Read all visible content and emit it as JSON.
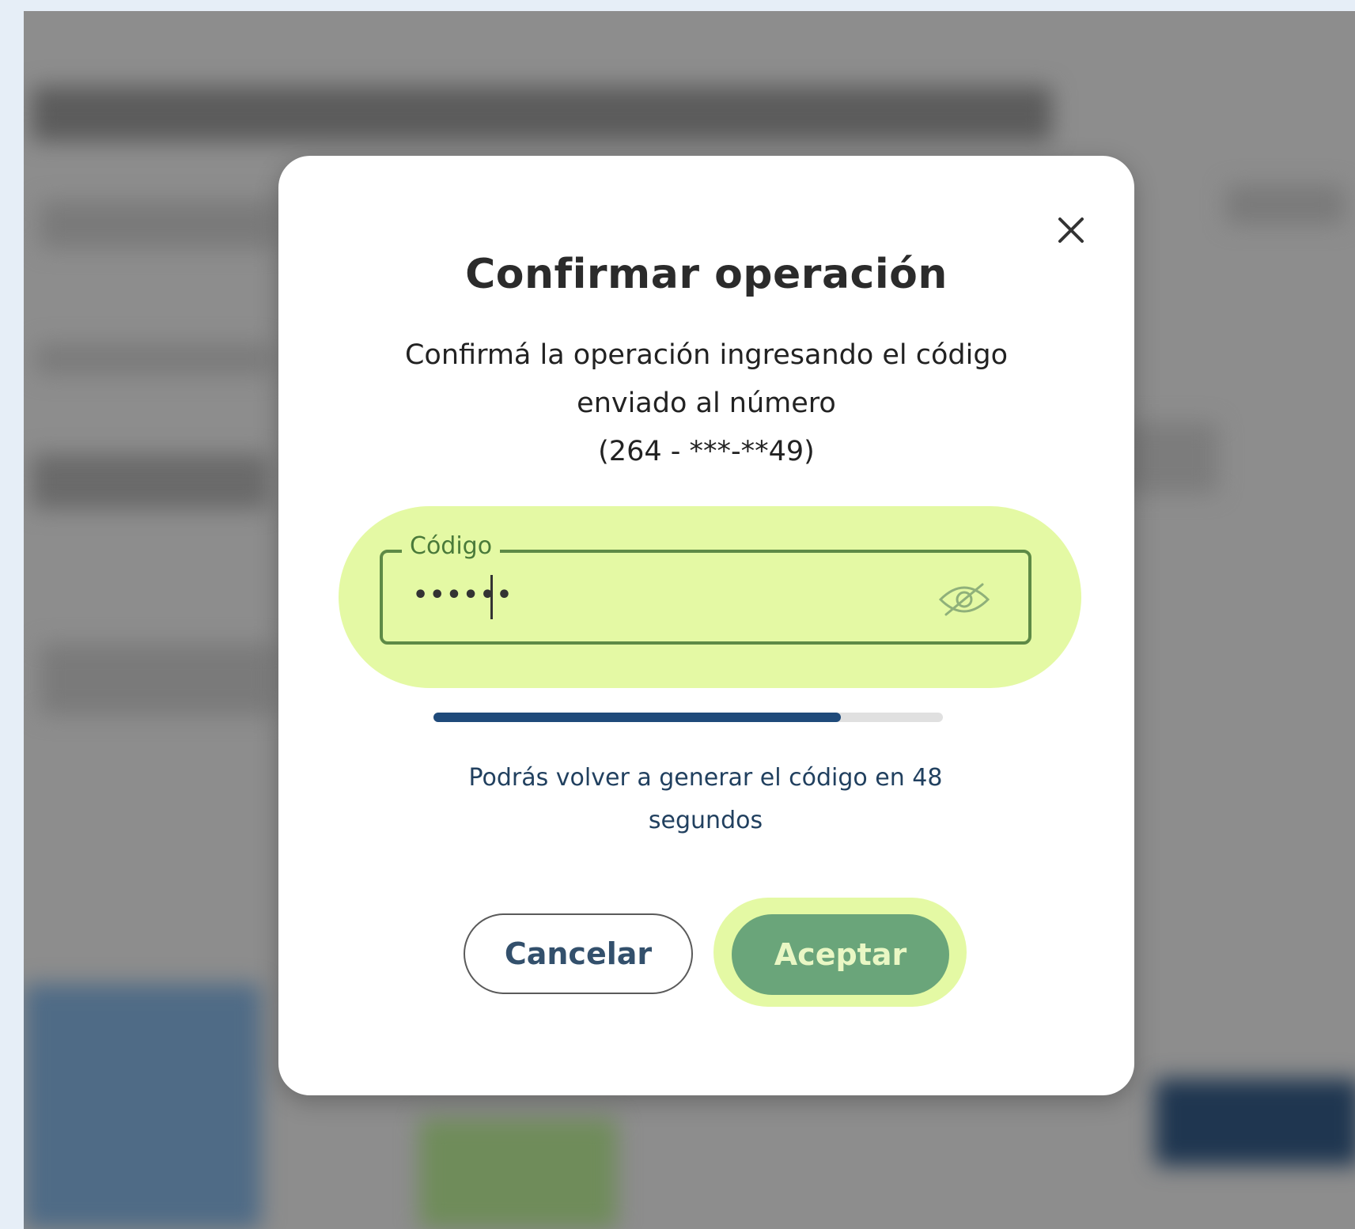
{
  "dialog": {
    "title": "Confirmar operación",
    "message_line1": "Confirmá la operación ingresando el código",
    "message_line2": "enviado al número",
    "message_line3": "(264 - ***-**49)",
    "code_field": {
      "label": "Código",
      "value": "••••••",
      "visibility_icon": "eye-slash-icon"
    },
    "countdown": {
      "progress_fraction": 0.8,
      "line1": "Podrás volver a generar el código en 48",
      "line2": "segundos"
    },
    "cancel_label": "Cancelar",
    "accept_label": "Aceptar",
    "close_icon": "close-icon"
  },
  "colors": {
    "highlight": "#e4f9a4",
    "field_border": "#5e8a46",
    "progress": "#1f4a7a",
    "accept_button": "#6aa57a",
    "overlay": "#8d8d8d"
  }
}
